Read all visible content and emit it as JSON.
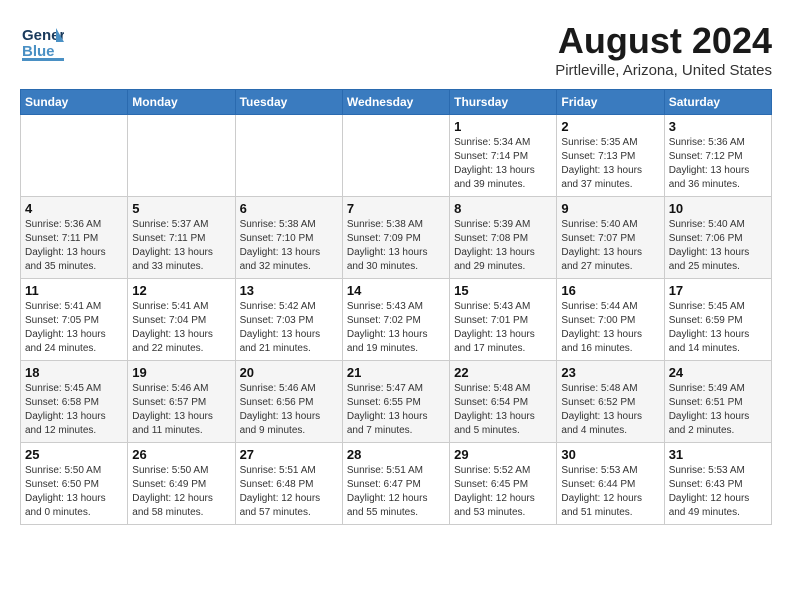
{
  "header": {
    "logo": {
      "line1": "General",
      "line2": "Blue"
    },
    "title": "August 2024",
    "subtitle": "Pirtleville, Arizona, United States"
  },
  "weekdays": [
    "Sunday",
    "Monday",
    "Tuesday",
    "Wednesday",
    "Thursday",
    "Friday",
    "Saturday"
  ],
  "weeks": [
    [
      {
        "day": "",
        "info": ""
      },
      {
        "day": "",
        "info": ""
      },
      {
        "day": "",
        "info": ""
      },
      {
        "day": "",
        "info": ""
      },
      {
        "day": "1",
        "info": "Sunrise: 5:34 AM\nSunset: 7:14 PM\nDaylight: 13 hours\nand 39 minutes."
      },
      {
        "day": "2",
        "info": "Sunrise: 5:35 AM\nSunset: 7:13 PM\nDaylight: 13 hours\nand 37 minutes."
      },
      {
        "day": "3",
        "info": "Sunrise: 5:36 AM\nSunset: 7:12 PM\nDaylight: 13 hours\nand 36 minutes."
      }
    ],
    [
      {
        "day": "4",
        "info": "Sunrise: 5:36 AM\nSunset: 7:11 PM\nDaylight: 13 hours\nand 35 minutes."
      },
      {
        "day": "5",
        "info": "Sunrise: 5:37 AM\nSunset: 7:11 PM\nDaylight: 13 hours\nand 33 minutes."
      },
      {
        "day": "6",
        "info": "Sunrise: 5:38 AM\nSunset: 7:10 PM\nDaylight: 13 hours\nand 32 minutes."
      },
      {
        "day": "7",
        "info": "Sunrise: 5:38 AM\nSunset: 7:09 PM\nDaylight: 13 hours\nand 30 minutes."
      },
      {
        "day": "8",
        "info": "Sunrise: 5:39 AM\nSunset: 7:08 PM\nDaylight: 13 hours\nand 29 minutes."
      },
      {
        "day": "9",
        "info": "Sunrise: 5:40 AM\nSunset: 7:07 PM\nDaylight: 13 hours\nand 27 minutes."
      },
      {
        "day": "10",
        "info": "Sunrise: 5:40 AM\nSunset: 7:06 PM\nDaylight: 13 hours\nand 25 minutes."
      }
    ],
    [
      {
        "day": "11",
        "info": "Sunrise: 5:41 AM\nSunset: 7:05 PM\nDaylight: 13 hours\nand 24 minutes."
      },
      {
        "day": "12",
        "info": "Sunrise: 5:41 AM\nSunset: 7:04 PM\nDaylight: 13 hours\nand 22 minutes."
      },
      {
        "day": "13",
        "info": "Sunrise: 5:42 AM\nSunset: 7:03 PM\nDaylight: 13 hours\nand 21 minutes."
      },
      {
        "day": "14",
        "info": "Sunrise: 5:43 AM\nSunset: 7:02 PM\nDaylight: 13 hours\nand 19 minutes."
      },
      {
        "day": "15",
        "info": "Sunrise: 5:43 AM\nSunset: 7:01 PM\nDaylight: 13 hours\nand 17 minutes."
      },
      {
        "day": "16",
        "info": "Sunrise: 5:44 AM\nSunset: 7:00 PM\nDaylight: 13 hours\nand 16 minutes."
      },
      {
        "day": "17",
        "info": "Sunrise: 5:45 AM\nSunset: 6:59 PM\nDaylight: 13 hours\nand 14 minutes."
      }
    ],
    [
      {
        "day": "18",
        "info": "Sunrise: 5:45 AM\nSunset: 6:58 PM\nDaylight: 13 hours\nand 12 minutes."
      },
      {
        "day": "19",
        "info": "Sunrise: 5:46 AM\nSunset: 6:57 PM\nDaylight: 13 hours\nand 11 minutes."
      },
      {
        "day": "20",
        "info": "Sunrise: 5:46 AM\nSunset: 6:56 PM\nDaylight: 13 hours\nand 9 minutes."
      },
      {
        "day": "21",
        "info": "Sunrise: 5:47 AM\nSunset: 6:55 PM\nDaylight: 13 hours\nand 7 minutes."
      },
      {
        "day": "22",
        "info": "Sunrise: 5:48 AM\nSunset: 6:54 PM\nDaylight: 13 hours\nand 5 minutes."
      },
      {
        "day": "23",
        "info": "Sunrise: 5:48 AM\nSunset: 6:52 PM\nDaylight: 13 hours\nand 4 minutes."
      },
      {
        "day": "24",
        "info": "Sunrise: 5:49 AM\nSunset: 6:51 PM\nDaylight: 13 hours\nand 2 minutes."
      }
    ],
    [
      {
        "day": "25",
        "info": "Sunrise: 5:50 AM\nSunset: 6:50 PM\nDaylight: 13 hours\nand 0 minutes."
      },
      {
        "day": "26",
        "info": "Sunrise: 5:50 AM\nSunset: 6:49 PM\nDaylight: 12 hours\nand 58 minutes."
      },
      {
        "day": "27",
        "info": "Sunrise: 5:51 AM\nSunset: 6:48 PM\nDaylight: 12 hours\nand 57 minutes."
      },
      {
        "day": "28",
        "info": "Sunrise: 5:51 AM\nSunset: 6:47 PM\nDaylight: 12 hours\nand 55 minutes."
      },
      {
        "day": "29",
        "info": "Sunrise: 5:52 AM\nSunset: 6:45 PM\nDaylight: 12 hours\nand 53 minutes."
      },
      {
        "day": "30",
        "info": "Sunrise: 5:53 AM\nSunset: 6:44 PM\nDaylight: 12 hours\nand 51 minutes."
      },
      {
        "day": "31",
        "info": "Sunrise: 5:53 AM\nSunset: 6:43 PM\nDaylight: 12 hours\nand 49 minutes."
      }
    ]
  ]
}
